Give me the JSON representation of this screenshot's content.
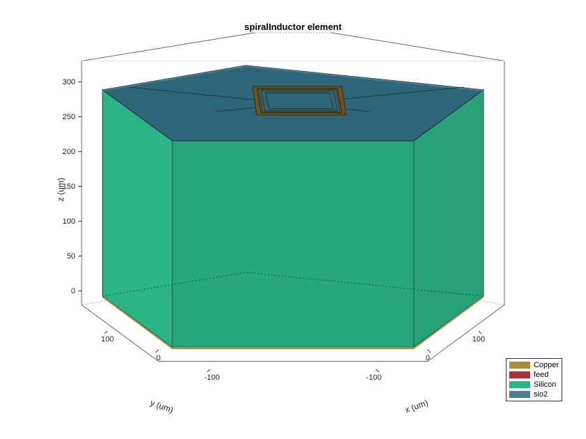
{
  "chart_data": {
    "type": "3d",
    "title": "spiralInductor element",
    "xlabel": "x (um)",
    "ylabel": "y (um)",
    "zlabel": "z (um)",
    "x_ticks": [
      -100,
      0,
      100
    ],
    "y_ticks": [
      -100,
      0,
      100
    ],
    "z_ticks": [
      0,
      50,
      100,
      150,
      200,
      250,
      300
    ],
    "xlim": [
      -150,
      150
    ],
    "ylim": [
      -150,
      150
    ],
    "zlim": [
      -20,
      330
    ],
    "legend": [
      "Copper",
      "feed",
      "Silicon",
      "sio2"
    ],
    "colors": {
      "Copper": "#ad8d3c",
      "feed": "#ad2f36",
      "Silicon": "#2cb486",
      "sio2": "#4b7c8f",
      "sio2_top": "#2e6578"
    },
    "view_az": -37.5,
    "view_el": 30,
    "box_extent": {
      "x": [
        -150,
        150
      ],
      "y": [
        -150,
        150
      ],
      "z": [
        -10,
        300
      ]
    }
  },
  "ticks": {
    "x": {
      "m100": "-100",
      "z": "0",
      "p100": "100"
    },
    "y": {
      "m100": "-100",
      "z": "0",
      "p100": "100"
    },
    "z": {
      "t0": "0",
      "t50": "50",
      "t100": "100",
      "t150": "150",
      "t200": "200",
      "t250": "250",
      "t300": "300"
    }
  }
}
